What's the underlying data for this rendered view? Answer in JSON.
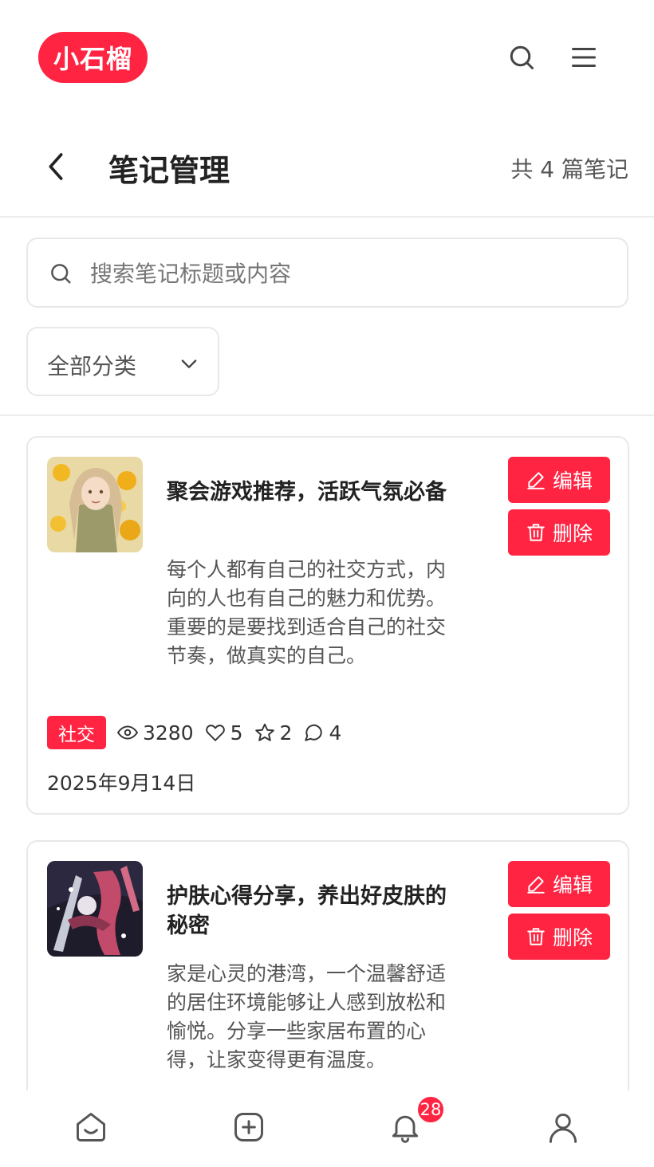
{
  "colors": {
    "brand": "#ff2442",
    "text": "#333333",
    "muted": "#555555",
    "border": "#e8e8e8"
  },
  "header": {
    "logo_text": "小石榴",
    "search_icon": "search-icon",
    "menu_icon": "menu-icon"
  },
  "titlebar": {
    "title": "笔记管理",
    "count_label": "共 4 篇笔记"
  },
  "search": {
    "placeholder": "搜索笔记标题或内容",
    "value": ""
  },
  "filter": {
    "selected": "全部分类"
  },
  "actions": {
    "edit_label": "编辑",
    "delete_label": "删除"
  },
  "notes": [
    {
      "title": "聚会游戏推荐，活跃气氛必备",
      "body": "每个人都有自己的社交方式，内向的人也有自己的魅力和优势。重要的是要找到适合自己的社交节奏，做真实的自己。",
      "tag": "社交",
      "views": "3280",
      "likes": "5",
      "favorites": "2",
      "comments": "4",
      "date": "2025年9月14日"
    },
    {
      "title": "护肤心得分享，养出好皮肤的秘密",
      "body": "家是心灵的港湾，一个温馨舒适的居住环境能够让人感到放松和愉悦。分享一些家居布置的心得，让家变得更有温度。"
    }
  ],
  "tabbar": {
    "notification_count": "28"
  }
}
